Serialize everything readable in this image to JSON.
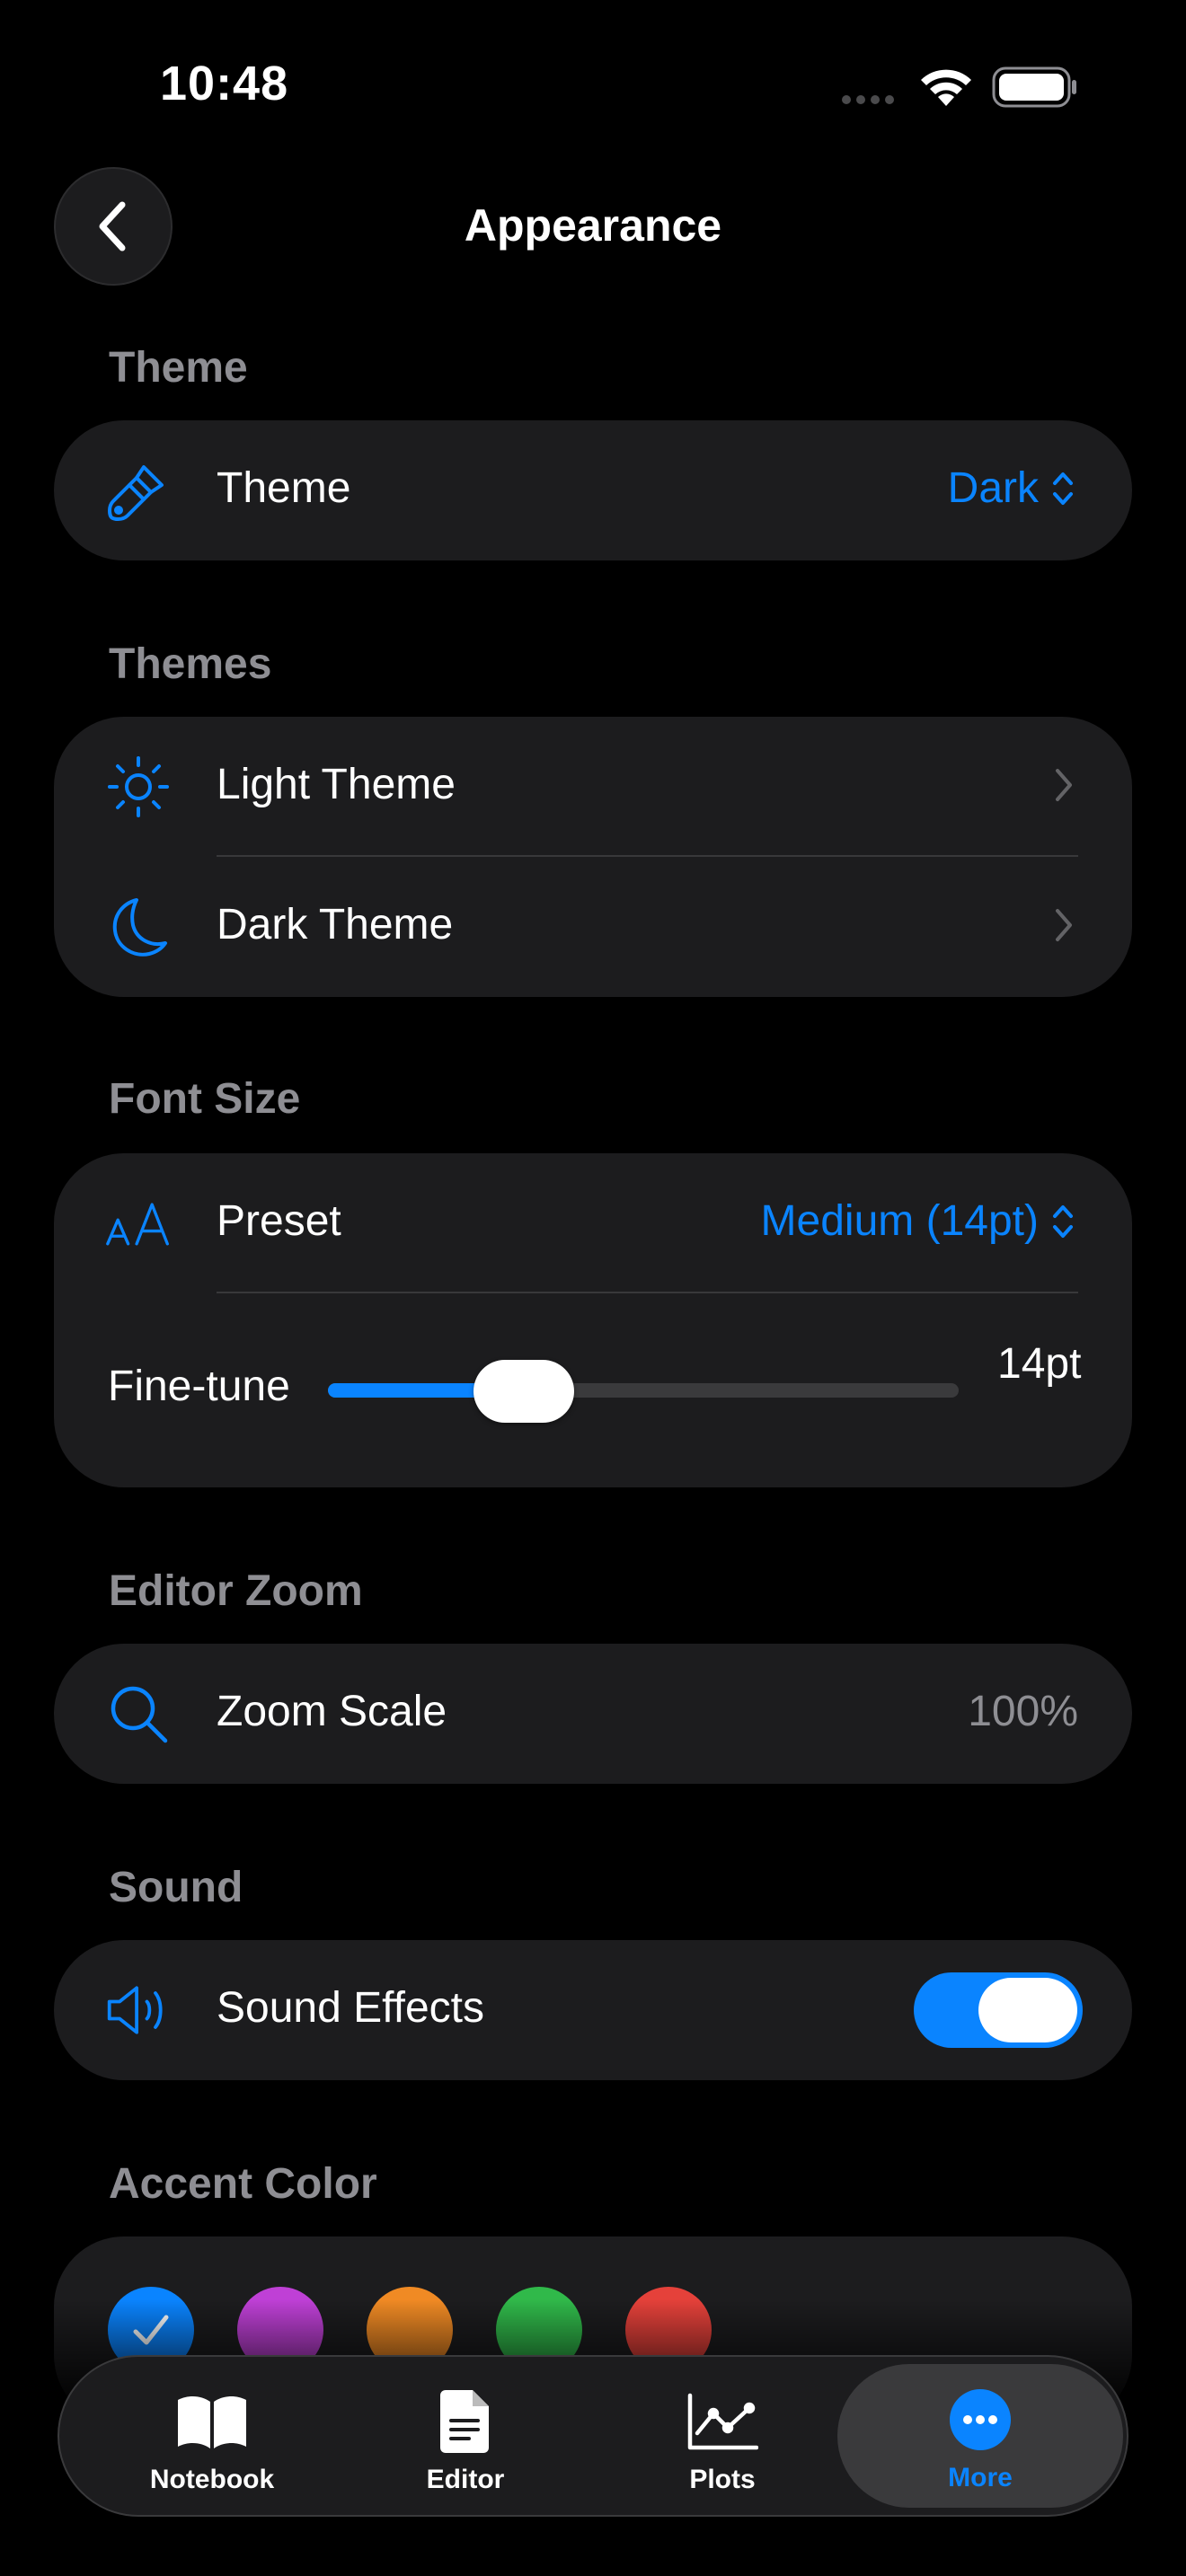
{
  "status_bar": {
    "time": "10:48"
  },
  "nav": {
    "title": "Appearance"
  },
  "theme_section": {
    "label": "Theme",
    "row": {
      "label": "Theme",
      "value": "Dark",
      "icon": "paintbrush-icon"
    }
  },
  "themes_section": {
    "label": "Themes",
    "rows": [
      {
        "label": "Light Theme",
        "icon": "sun-icon"
      },
      {
        "label": "Dark Theme",
        "icon": "moon-icon"
      }
    ]
  },
  "font_size_section": {
    "label": "Font Size",
    "preset": {
      "label": "Preset",
      "value": "Medium (14pt)",
      "icon": "text-size-icon"
    },
    "fine_tune": {
      "label": "Fine-tune",
      "value": "14pt",
      "fraction": 0.31
    }
  },
  "editor_zoom_section": {
    "label": "Editor Zoom",
    "row": {
      "label": "Zoom Scale",
      "value": "100%",
      "icon": "magnifier-icon"
    }
  },
  "sound_section": {
    "label": "Sound",
    "row": {
      "label": "Sound Effects",
      "enabled": true,
      "icon": "speaker-icon"
    }
  },
  "accent_section": {
    "label": "Accent Color",
    "colors": [
      "#0a84ff",
      "#bf40d6",
      "#f08a24",
      "#30b94a",
      "#e5413a"
    ],
    "selected": 0
  },
  "tabbar": {
    "tabs": [
      {
        "label": "Notebook",
        "icon": "book-icon"
      },
      {
        "label": "Editor",
        "icon": "document-icon"
      },
      {
        "label": "Plots",
        "icon": "chart-icon"
      },
      {
        "label": "More",
        "icon": "ellipsis-circle-icon"
      }
    ],
    "active": 3
  },
  "colors": {
    "accent": "#0a84ff",
    "card": "#1c1c1e",
    "secondary_text": "#8e8e93"
  }
}
